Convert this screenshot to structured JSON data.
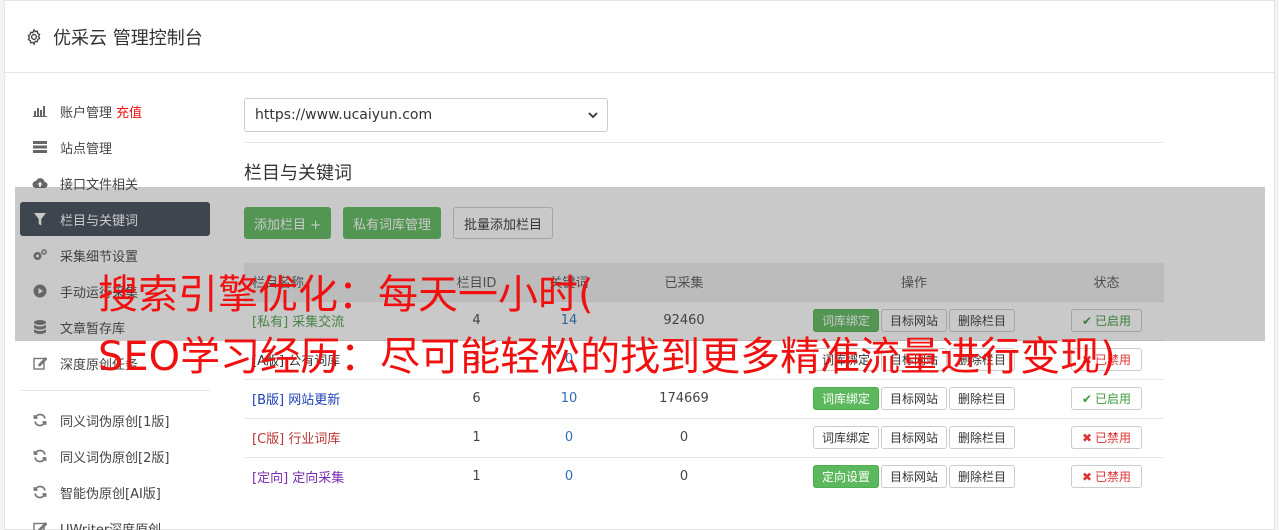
{
  "header": {
    "title": "优采云 管理控制台"
  },
  "sidebar": {
    "items": [
      {
        "label": "账户管理",
        "extra": "充值",
        "icon": "bar-chart-icon"
      },
      {
        "label": "站点管理",
        "icon": "server-icon"
      },
      {
        "label": "接口文件相关",
        "icon": "cloud-upload-icon"
      },
      {
        "label": "栏目与关键词",
        "icon": "filter-icon",
        "active": true
      },
      {
        "label": "采集细节设置",
        "icon": "cogs-icon"
      },
      {
        "label": "手动运行采集",
        "icon": "play-icon"
      },
      {
        "label": "文章暂存库",
        "icon": "database-icon"
      },
      {
        "label": "深度原创任务",
        "icon": "edit-icon"
      }
    ],
    "items2": [
      {
        "label": "同义词伪原创[1版]",
        "icon": "refresh-icon"
      },
      {
        "label": "同义词伪原创[2版]",
        "icon": "refresh-icon"
      },
      {
        "label": "智能伪原创[AI版]",
        "icon": "refresh-icon"
      },
      {
        "label": "UWriter深度原创",
        "icon": "edit-icon"
      }
    ]
  },
  "main": {
    "site_select": "https://www.ucaiyun.com",
    "section_title": "栏目与关键词",
    "buttons": {
      "add": "添加栏目 +",
      "private_lib": "私有词库管理",
      "batch_add": "批量添加栏目"
    },
    "table": {
      "headers": [
        "栏目名称",
        "栏目ID",
        "关键词",
        "已采集",
        "操作",
        "状态"
      ],
      "rows": [
        {
          "tag": "[私有]",
          "name": "采集交流",
          "id": "4",
          "kw": "14",
          "collected": "92460",
          "op1": "词库绑定",
          "op1_green": true,
          "op2": "目标网站",
          "op3": "删除栏目",
          "status": "已启用",
          "on": true
        },
        {
          "tag": "[A版]",
          "name": "公有词库",
          "id": "1",
          "kw": "0",
          "collected": "",
          "op1": "词库绑定",
          "op1_green": false,
          "op2": "目标网站",
          "op3": "删除栏目",
          "status": "已禁用",
          "on": false
        },
        {
          "tag": "[B版]",
          "name": "网站更新",
          "id": "6",
          "kw": "10",
          "collected": "174669",
          "op1": "词库绑定",
          "op1_green": true,
          "op2": "目标网站",
          "op3": "删除栏目",
          "status": "已启用",
          "on": true
        },
        {
          "tag": "[C版]",
          "name": "行业词库",
          "id": "1",
          "kw": "0",
          "collected": "0",
          "op1": "词库绑定",
          "op1_green": false,
          "op2": "目标网站",
          "op3": "删除栏目",
          "status": "已禁用",
          "on": false
        },
        {
          "tag": "[定向]",
          "name": "定向采集",
          "id": "1",
          "kw": "0",
          "collected": "0",
          "op1": "定向设置",
          "op1_green": true,
          "op2": "目标网站",
          "op3": "删除栏目",
          "status": "已禁用",
          "on": false
        }
      ]
    }
  },
  "overlay": {
    "line1": "搜索引擎优化：每天一小时(",
    "line2": "SEO学习经历：尽可能轻松的找到更多精准流量进行变现)"
  }
}
